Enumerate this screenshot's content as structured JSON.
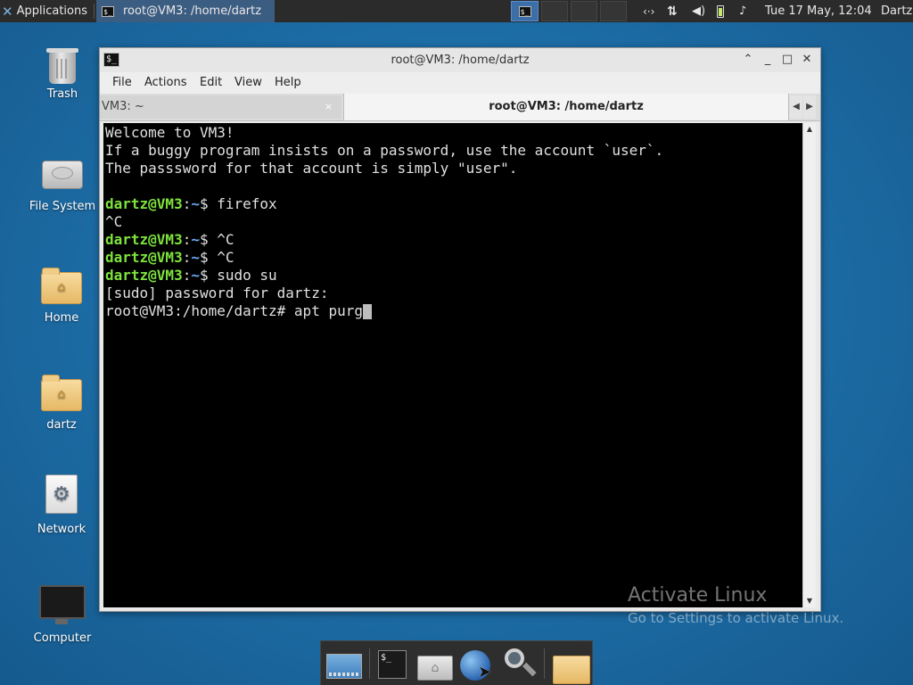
{
  "top_panel": {
    "applications_label": "Applications",
    "task_label": "root@VM3: /home/dartz",
    "clock": "Tue 17 May, 12:04",
    "user": "Dartz",
    "network_glyph": "‹·›",
    "updown_glyph": "⇅",
    "volume_glyph": "🔊",
    "bell_glyph": "🔔"
  },
  "desktop_icons": [
    {
      "label": "Trash",
      "icon": "trash-icon"
    },
    {
      "label": "File System",
      "icon": "drive-icon"
    },
    {
      "label": "Home",
      "icon": "home-folder-icon"
    },
    {
      "label": "dartz",
      "icon": "folder-icon"
    },
    {
      "label": "Network",
      "icon": "network-icon"
    },
    {
      "label": "Computer",
      "icon": "monitor-icon"
    }
  ],
  "window": {
    "title": "root@VM3: /home/dartz",
    "menu": [
      "File",
      "Actions",
      "Edit",
      "View",
      "Help"
    ],
    "tabs": [
      {
        "label": "VM3: ~",
        "close": "×"
      },
      {
        "label": "root@VM3: /home/dartz"
      }
    ],
    "controls": {
      "shade": "⌃",
      "minimize": "_",
      "maximize": "□",
      "close": "✕"
    }
  },
  "terminal": {
    "lines": [
      {
        "type": "text",
        "text": "Welcome to VM3!"
      },
      {
        "type": "text",
        "text": "If a buggy program insists on a password, use the account `user`."
      },
      {
        "type": "text",
        "text": "The passsword for that account is simply \"user\"."
      },
      {
        "type": "text",
        "text": ""
      },
      {
        "type": "prompt",
        "user": "dartz@VM3",
        "path": "~",
        "cmd": "firefox"
      },
      {
        "type": "text",
        "text": "^C"
      },
      {
        "type": "prompt",
        "user": "dartz@VM3",
        "path": "~",
        "cmd": "^C"
      },
      {
        "type": "prompt",
        "user": "dartz@VM3",
        "path": "~",
        "cmd": "^C"
      },
      {
        "type": "prompt",
        "user": "dartz@VM3",
        "path": "~",
        "cmd": "sudo su"
      },
      {
        "type": "text",
        "text": "[sudo] password for dartz:"
      },
      {
        "type": "root",
        "text": "root@VM3:/home/dartz# apt purg"
      }
    ]
  },
  "watermark": {
    "title": "Activate Linux",
    "subtitle": "Go to Settings to activate Linux."
  },
  "dock": {
    "items": [
      "show-desktop",
      "terminal",
      "file-manager",
      "web-browser",
      "app-finder",
      "files-folder"
    ]
  },
  "colors": {
    "prompt_user": "#7ee33c",
    "prompt_path": "#6aa8f0",
    "desktop_bg": "#1e6fa9",
    "panel_bg": "#2b2b2b"
  }
}
